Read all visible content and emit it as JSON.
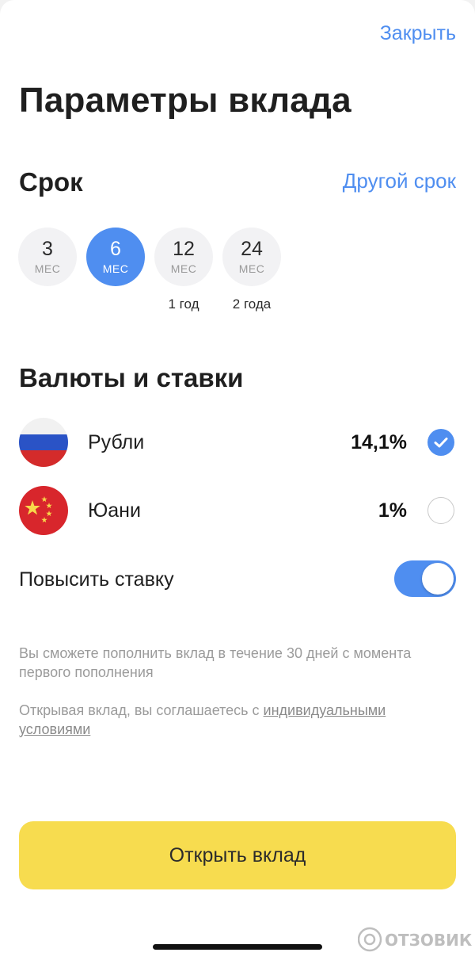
{
  "header": {
    "close_label": "Закрыть",
    "title": "Параметры вклада"
  },
  "term": {
    "heading": "Срок",
    "other_label": "Другой срок",
    "options": [
      {
        "value": "3",
        "unit": "МЕС",
        "sub": ""
      },
      {
        "value": "6",
        "unit": "МЕС",
        "sub": "",
        "selected": true
      },
      {
        "value": "12",
        "unit": "МЕС",
        "sub": "1 год"
      },
      {
        "value": "24",
        "unit": "МЕС",
        "sub": "2 года"
      }
    ]
  },
  "currencies": {
    "heading": "Валюты и ставки",
    "items": [
      {
        "name": "Рубли",
        "rate": "14,1%",
        "selected": true,
        "icon": "russia-flag-icon"
      },
      {
        "name": "Юани",
        "rate": "1%",
        "selected": false,
        "icon": "china-flag-icon"
      }
    ]
  },
  "boost": {
    "label": "Повысить ставку",
    "enabled": true
  },
  "notes": {
    "replenish": "Вы сможете пополнить вклад в течение 30 дней с момента первого пополнения",
    "agreement_prefix": "Открывая вклад, вы соглашаетесь с ",
    "agreement_link": "индивидуальными условиями"
  },
  "actions": {
    "open_label": "Открыть вклад"
  },
  "watermark": {
    "text": "ОТЗОВИК"
  },
  "colors": {
    "accent": "#4f8ef0",
    "button": "#f7dc4f"
  }
}
